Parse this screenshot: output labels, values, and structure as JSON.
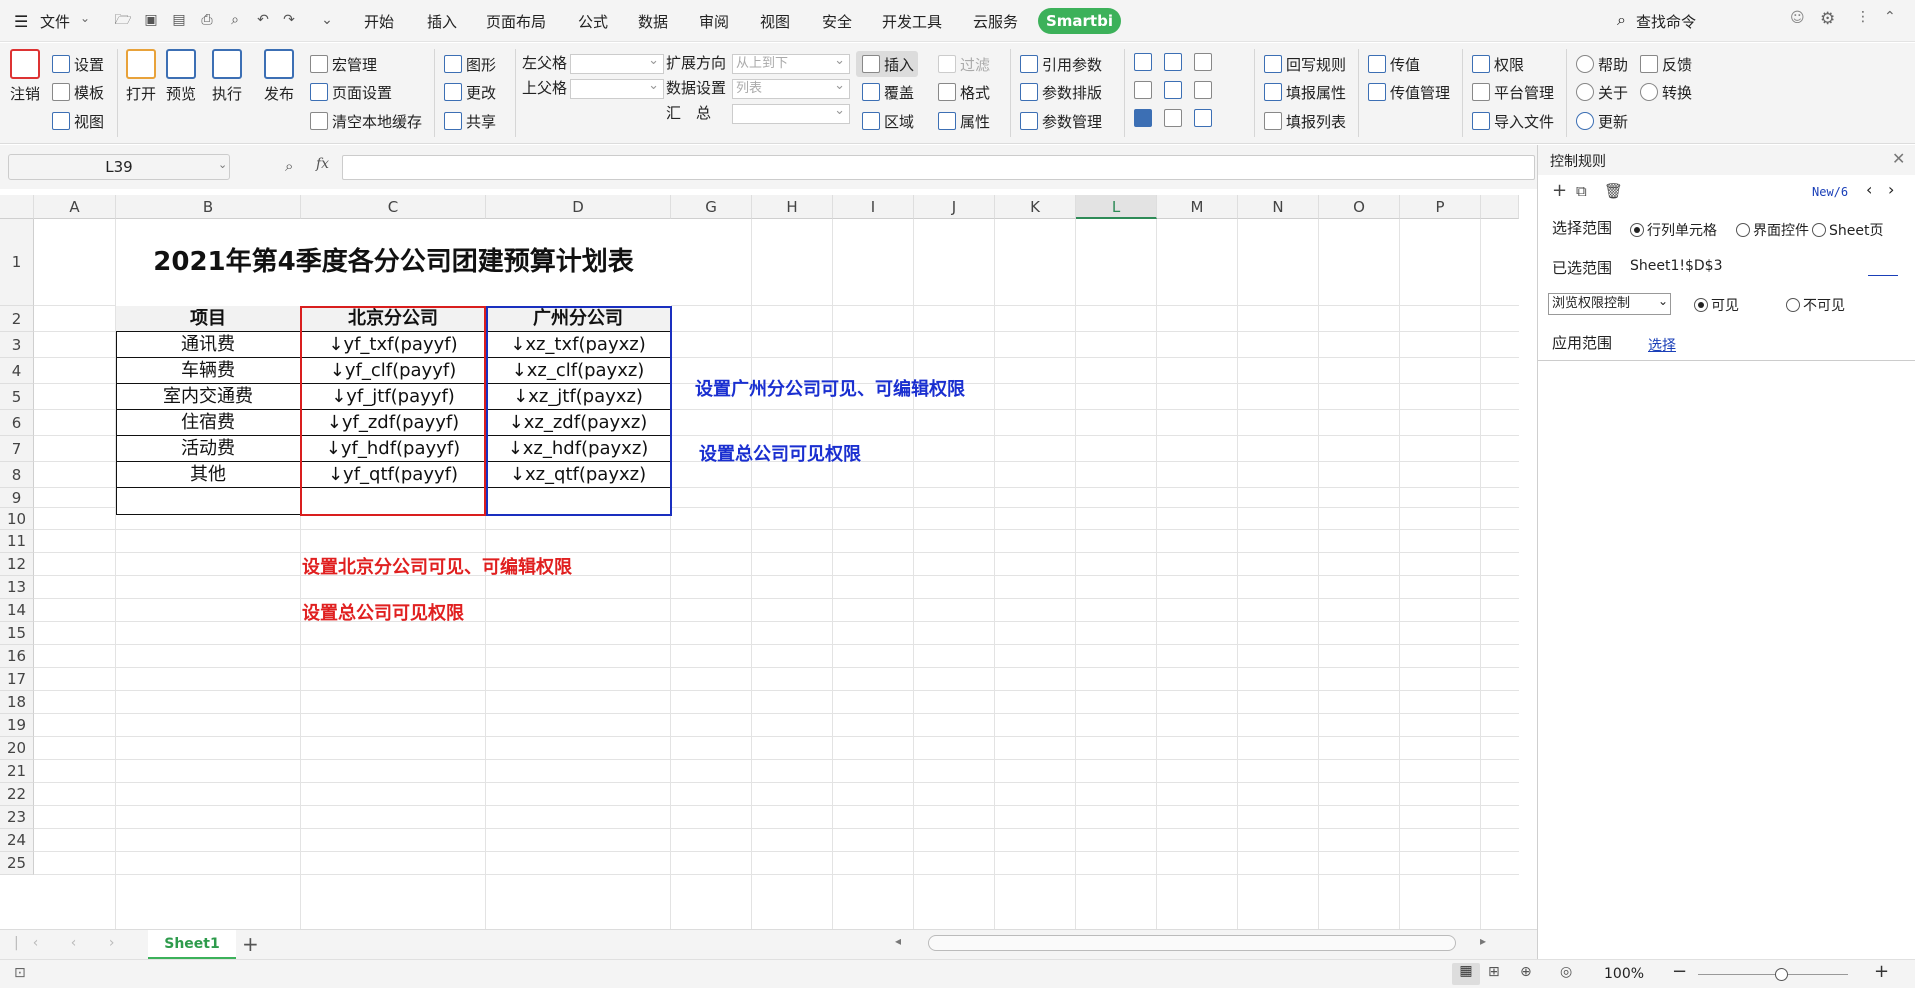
{
  "menubar": {
    "file_label": "文件",
    "tabs": [
      "开始",
      "插入",
      "页面布局",
      "公式",
      "数据",
      "审阅",
      "视图",
      "安全",
      "开发工具",
      "云服务"
    ],
    "smartbi": "Smartbi",
    "search": "查找命令"
  },
  "ribbon": {
    "logout": "注销",
    "settings": "设置",
    "template": "模板",
    "view": "视图",
    "open": "打开",
    "preview": "预览",
    "execute": "执行",
    "publish": "发布",
    "macro": "宏管理",
    "page_setup": "页面设置",
    "clear_cache": "清空本地缓存",
    "shape": "图形",
    "change": "更改",
    "share": "共享",
    "left_parent": "左父格",
    "top_parent": "上父格",
    "expand_dir": "扩展方向",
    "expand_dir_value": "从上到下",
    "data_setting": "数据设置",
    "data_setting_value": "列表",
    "summary": "汇　总",
    "insert": "插入",
    "filter": "过滤",
    "cover": "覆盖",
    "format": "格式",
    "area": "区域",
    "attribute": "属性",
    "ref_param": "引用参数",
    "param_layout": "参数排版",
    "param_manage": "参数管理",
    "writeback_rule": "回写规则",
    "fill_attr": "填报属性",
    "fill_list": "填报列表",
    "pass_value": "传值",
    "pass_value_manage": "传值管理",
    "permission": "权限",
    "platform_manage": "平台管理",
    "import_file": "导入文件",
    "help": "帮助",
    "feedback": "反馈",
    "about": "关于",
    "convert": "转换",
    "update": "更新"
  },
  "formula_bar": {
    "name_box": "L39",
    "fx": "fx",
    "value": ""
  },
  "sheet": {
    "columns": [
      "A",
      "B",
      "C",
      "D",
      "G",
      "H",
      "I",
      "J",
      "K",
      "L",
      "M",
      "N",
      "O",
      "P"
    ],
    "rows": [
      "1",
      "2",
      "3",
      "4",
      "5",
      "6",
      "7",
      "8",
      "9",
      "10",
      "11",
      "12",
      "13",
      "14",
      "15",
      "16",
      "17",
      "18",
      "19",
      "20",
      "21",
      "22",
      "23",
      "24",
      "25"
    ],
    "title": "2021年第4季度各分公司团建预算计划表",
    "headers": [
      "项目",
      "北京分公司",
      "广州分公司"
    ],
    "table_rows": [
      [
        "通讯费",
        "↓yf_txf(payyf)",
        "↓xz_txf(payxz)"
      ],
      [
        "车辆费",
        "↓yf_clf(payyf)",
        "↓xz_clf(payxz)"
      ],
      [
        "室内交通费",
        "↓yf_jtf(payyf)",
        "↓xz_jtf(payxz)"
      ],
      [
        "住宿费",
        "↓yf_zdf(payyf)",
        "↓xz_zdf(payxz)"
      ],
      [
        "活动费",
        "↓yf_hdf(payyf)",
        "↓xz_hdf(payxz)"
      ],
      [
        "其他",
        "↓yf_qtf(payyf)",
        "↓xz_qtf(payxz)"
      ]
    ],
    "notes": {
      "blue1": "设置广州分公司可见、可编辑权限",
      "blue2": "设置总公司可见权限",
      "red1": "设置北京分公司可见、可编辑权限",
      "red2": "设置总公司可见权限"
    },
    "colors": {
      "red": "#e02020",
      "blue": "#1a2fd0"
    },
    "sheet_tab": "Sheet1"
  },
  "panel": {
    "title": "控制规则",
    "nav_text": "New/6",
    "select_range_label": "选择范围",
    "radio_row_col": "行列单元格",
    "radio_ui": "界面控件",
    "radio_sheet": "Sheet页",
    "selected_label": "已选范围",
    "selected_value": "Sheet1!$D$3",
    "control_type": "浏览权限控制",
    "visible": "可见",
    "invisible": "不可见",
    "apply_label": "应用范围",
    "apply_link": "选择"
  },
  "status": {
    "zoom": "100%"
  }
}
